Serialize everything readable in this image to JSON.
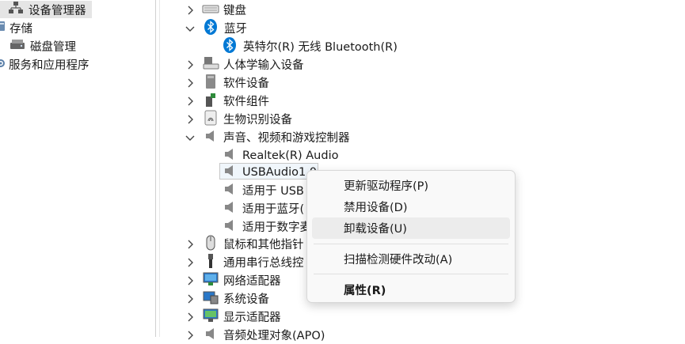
{
  "left_panel": {
    "items": [
      {
        "label": "设备管理器",
        "icon": "device-manager-icon",
        "selected": true
      },
      {
        "label": "存储",
        "icon": "storage-icon"
      },
      {
        "label": "磁盘管理",
        "icon": "disk-management-icon"
      },
      {
        "label": "服务和应用程序",
        "icon": "services-icon"
      }
    ]
  },
  "tree": {
    "items": [
      {
        "label": "键盘",
        "icon": "keyboard-icon",
        "expand": "collapsed"
      },
      {
        "label": "蓝牙",
        "icon": "bluetooth-icon",
        "expand": "expanded"
      },
      {
        "label": "英特尔(R) 无线 Bluetooth(R)",
        "icon": "bluetooth-icon",
        "child": true
      },
      {
        "label": "人体学输入设备",
        "icon": "hid-icon",
        "expand": "collapsed"
      },
      {
        "label": "软件设备",
        "icon": "software-device-icon",
        "expand": "collapsed"
      },
      {
        "label": "软件组件",
        "icon": "software-component-icon",
        "expand": "collapsed"
      },
      {
        "label": "生物识别设备",
        "icon": "fingerprint-icon",
        "expand": "collapsed"
      },
      {
        "label": "声音、视频和游戏控制器",
        "icon": "speaker-icon",
        "expand": "expanded"
      },
      {
        "label": "Realtek(R) Audio",
        "icon": "speaker-icon",
        "child": true
      },
      {
        "label": "USBAudio1.0",
        "icon": "speaker-icon",
        "child": true,
        "selected": true
      },
      {
        "label": "适用于 USB",
        "icon": "speaker-icon",
        "child": true
      },
      {
        "label": "适用于蓝牙(",
        "icon": "speaker-icon",
        "child": true
      },
      {
        "label": "适用于数字麦",
        "icon": "speaker-icon",
        "child": true
      },
      {
        "label": "鼠标和其他指针",
        "icon": "mouse-icon",
        "expand": "collapsed"
      },
      {
        "label": "通用串行总线控",
        "icon": "usb-icon",
        "expand": "collapsed"
      },
      {
        "label": "网络适配器",
        "icon": "network-adapter-icon",
        "expand": "collapsed"
      },
      {
        "label": "系统设备",
        "icon": "system-device-icon",
        "expand": "collapsed"
      },
      {
        "label": "显示适配器",
        "icon": "display-adapter-icon",
        "expand": "collapsed"
      },
      {
        "label": "音频处理对象(APO)",
        "icon": "speaker-icon",
        "expand": "collapsed"
      }
    ]
  },
  "context_menu": {
    "items": [
      {
        "label": "更新驱动程序(P)"
      },
      {
        "label": "禁用设备(D)"
      },
      {
        "label": "卸载设备(U)",
        "hover": true
      },
      {
        "label": "扫描检测硬件改动(A)"
      },
      {
        "label": "属性(R)",
        "bold": true
      }
    ]
  },
  "colors": {
    "bluetooth": "#0078d4",
    "selection_border": "#c7c7c7",
    "menu_hover": "#ececec"
  }
}
